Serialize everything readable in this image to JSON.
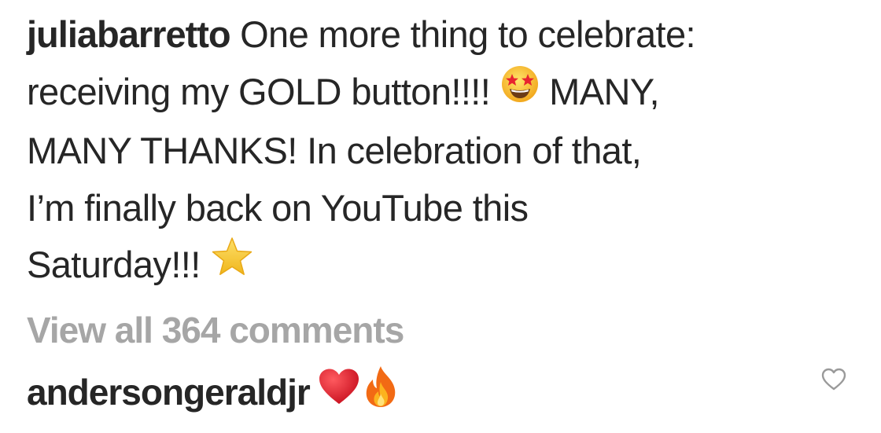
{
  "post": {
    "username": "juliabarretto",
    "caption_lines": [
      " One more thing to celebrate:",
      "receiving my GOLD button!!!! ",
      "MANY THANKS! In celebration of that,",
      "I’m finally back on YouTube this",
      "Saturday!!! "
    ],
    "caption_after_emoji": " MANY,",
    "emojis": {
      "line2": "star-struck-emoji",
      "line5": "star-emoji"
    }
  },
  "comments": {
    "view_all_label": "View all 364 comments"
  },
  "comment": {
    "username": "andersongeraldjr",
    "emojis": [
      "red-heart-emoji",
      "fire-emoji"
    ],
    "like_icon": "heart-outline-icon"
  },
  "colors": {
    "text": "#262626",
    "muted": "#a6a6a6",
    "heart_red": "#e0202f",
    "star_gold": "#f7c926",
    "fire_orange": "#f26a14"
  }
}
